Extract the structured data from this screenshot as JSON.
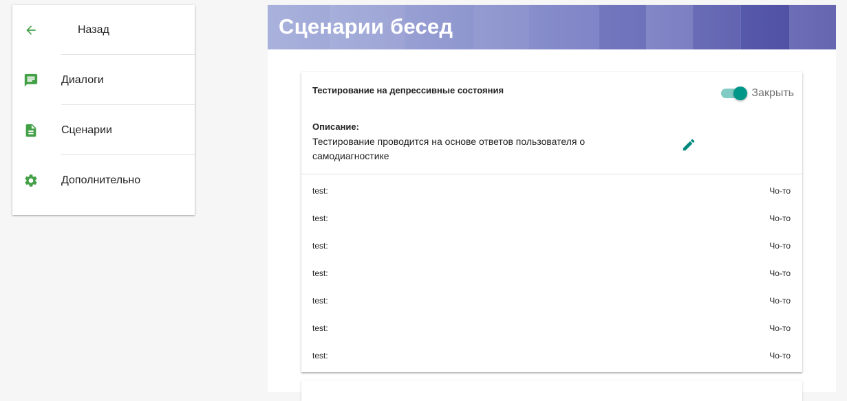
{
  "nav": {
    "items": [
      {
        "label": "Назад",
        "icon": "arrow-back-icon"
      },
      {
        "label": "Диалоги",
        "icon": "chat-icon"
      },
      {
        "label": "Сценарии",
        "icon": "document-icon"
      },
      {
        "label": "Дополнительно",
        "icon": "gear-icon"
      }
    ]
  },
  "header": {
    "title": "Сценарии бесед"
  },
  "scenario": {
    "title": "Тестирование на депрессивные состояния",
    "toggle_label": "Закрыть",
    "toggle_on": true,
    "description_heading": "Описание:",
    "description": "Тестирование проводится на основе ответов пользователя о самодиагностике",
    "rows": [
      {
        "key": "test:",
        "value": "Чо-то"
      },
      {
        "key": "test:",
        "value": "Чо-то"
      },
      {
        "key": "test:",
        "value": "Чо-то"
      },
      {
        "key": "test:",
        "value": "Чо-то"
      },
      {
        "key": "test:",
        "value": "Чо-то"
      },
      {
        "key": "test:",
        "value": "Чо-то"
      },
      {
        "key": "test:",
        "value": "Чо-то"
      }
    ]
  },
  "colors": {
    "nav_icon": "#43a047",
    "accent": "#009688",
    "accent_light": "#80cbc4"
  }
}
